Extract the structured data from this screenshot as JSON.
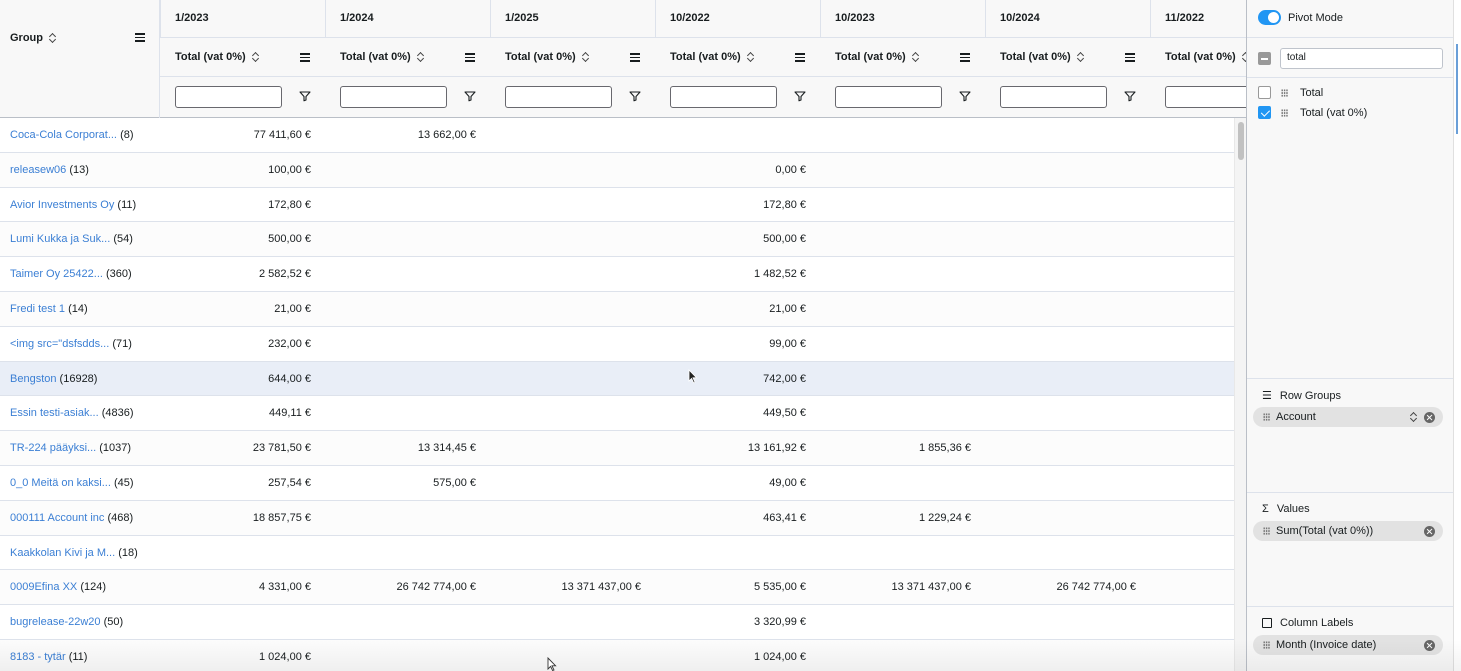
{
  "grid": {
    "group_header": "Group",
    "columns": [
      {
        "month": "1/2023",
        "sub": "Total (vat 0%)"
      },
      {
        "month": "1/2024",
        "sub": "Total (vat 0%)"
      },
      {
        "month": "1/2025",
        "sub": "Total (vat 0%)"
      },
      {
        "month": "10/2022",
        "sub": "Total (vat 0%)"
      },
      {
        "month": "10/2023",
        "sub": "Total (vat 0%)"
      },
      {
        "month": "10/2024",
        "sub": "Total (vat 0%)"
      },
      {
        "month": "11/2022",
        "sub": "Total (vat 0%)"
      }
    ],
    "rows": [
      {
        "name": "Coca-Cola Corporat...",
        "count": "(8)",
        "v": [
          "77 411,60 €",
          "13 662,00 €",
          "",
          "",
          "",
          "",
          ""
        ]
      },
      {
        "name": "releasew06",
        "count": "(13)",
        "v": [
          "100,00 €",
          "",
          "",
          "0,00 €",
          "",
          "",
          ""
        ]
      },
      {
        "name": "Avior Investments Oy",
        "count": "(11)",
        "v": [
          "172,80 €",
          "",
          "",
          "172,80 €",
          "",
          "",
          ""
        ]
      },
      {
        "name": "Lumi Kukka ja Suk...",
        "count": "(54)",
        "v": [
          "500,00 €",
          "",
          "",
          "500,00 €",
          "",
          "",
          ""
        ]
      },
      {
        "name": "Taimer Oy 25422...",
        "count": "(360)",
        "v": [
          "2 582,52 €",
          "",
          "",
          "1 482,52 €",
          "",
          "",
          ""
        ]
      },
      {
        "name": "Fredi test 1",
        "count": "(14)",
        "v": [
          "21,00 €",
          "",
          "",
          "21,00 €",
          "",
          "",
          ""
        ]
      },
      {
        "name": "<img src=\"dsfsdds...",
        "count": "(71)",
        "v": [
          "232,00 €",
          "",
          "",
          "99,00 €",
          "",
          "",
          ""
        ]
      },
      {
        "name": "Bengston",
        "count": "(16928)",
        "v": [
          "644,00 €",
          "",
          "",
          "742,00 €",
          "",
          "",
          ""
        ]
      },
      {
        "name": "Essin testi-asiak...",
        "count": "(4836)",
        "v": [
          "449,11 €",
          "",
          "",
          "449,50 €",
          "",
          "",
          ""
        ]
      },
      {
        "name": "TR-224 pääyksi...",
        "count": "(1037)",
        "v": [
          "23 781,50 €",
          "13 314,45 €",
          "",
          "13 161,92 €",
          "1 855,36 €",
          "",
          ""
        ]
      },
      {
        "name": "0_0 Meitä on kaksi...",
        "count": "(45)",
        "v": [
          "257,54 €",
          "575,00 €",
          "",
          "49,00 €",
          "",
          "",
          ""
        ]
      },
      {
        "name": "000111 Account inc",
        "count": "(468)",
        "v": [
          "18 857,75 €",
          "",
          "",
          "463,41 €",
          "1 229,24 €",
          "",
          ""
        ]
      },
      {
        "name": "Kaakkolan Kivi ja M...",
        "count": "(18)",
        "v": [
          "",
          "",
          "",
          "",
          "",
          "",
          ""
        ]
      },
      {
        "name": "0009Efina XX",
        "count": "(124)",
        "v": [
          "4 331,00 €",
          "26 742 774,00 €",
          "13 371 437,00 €",
          "5 535,00 €",
          "13 371 437,00 €",
          "26 742 774,00 €",
          ""
        ]
      },
      {
        "name": "bugrelease-22w20",
        "count": "(50)",
        "v": [
          "",
          "",
          "",
          "3 320,99 €",
          "",
          "",
          ""
        ]
      },
      {
        "name": "8183 - tytär",
        "count": "(11)",
        "v": [
          "1 024,00 €",
          "",
          "",
          "1 024,00 €",
          "",
          "",
          ""
        ]
      }
    ]
  },
  "panel": {
    "pivot_label": "Pivot Mode",
    "search_value": "total",
    "columns": [
      {
        "label": "Total",
        "checked": false
      },
      {
        "label": "Total (vat 0%)",
        "checked": true
      }
    ],
    "row_groups_title": "Row Groups",
    "row_group_item": "Account",
    "values_title": "Values",
    "values_item": "Sum(Total (vat 0%))",
    "column_labels_title": "Column Labels",
    "column_labels_item": "Month (Invoice date)"
  },
  "colors": {
    "accent": "#2196f3",
    "link": "#3b7fd4",
    "header_bg": "#f8f8f8"
  }
}
